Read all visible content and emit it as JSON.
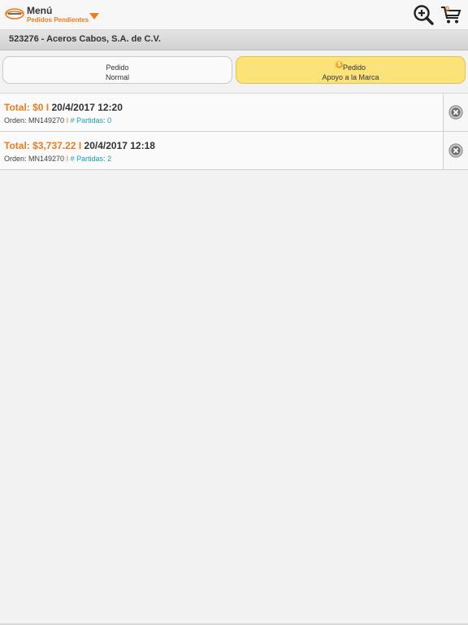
{
  "header": {
    "menu_title": "Menú",
    "menu_subtitle": "Pedidos Pendientes",
    "cart_count": "0",
    "accent_color": "#f07c1e"
  },
  "customer": {
    "label": "523276 - Aceros Cabos, S.A. de C.V."
  },
  "tabs": [
    {
      "line1": "Pedido",
      "line2": "Normal",
      "selected": false
    },
    {
      "line1": "Pedido",
      "line2": "Apoyo a la Marca",
      "selected": true,
      "badge": "$"
    }
  ],
  "orders": [
    {
      "total": "Total: $0",
      "sep": "I",
      "date": "20/4/2017 12:20",
      "orden": "Orden: MN149270",
      "bar": "I",
      "partidas": "# Partidas: 0"
    },
    {
      "total": "Total: $3,737.22",
      "sep": "I",
      "date": "20/4/2017 12:18",
      "orden": "Orden: MN149270",
      "bar": "I",
      "partidas": "# Partidas: 2"
    }
  ]
}
